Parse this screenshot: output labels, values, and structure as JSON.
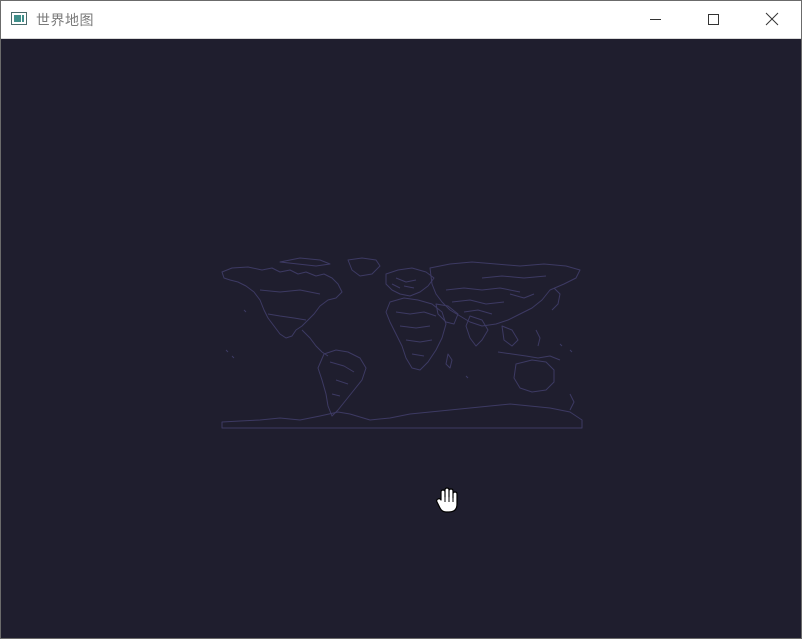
{
  "window": {
    "title": "世界地图",
    "icon": "app-window-icon",
    "controls": {
      "minimize": "minimize-icon",
      "maximize": "maximize-icon",
      "close": "close-icon"
    }
  },
  "canvas": {
    "background": "#1f1e2e",
    "map_stroke": "#3d3a63",
    "cursor": "hand-grab-icon"
  }
}
